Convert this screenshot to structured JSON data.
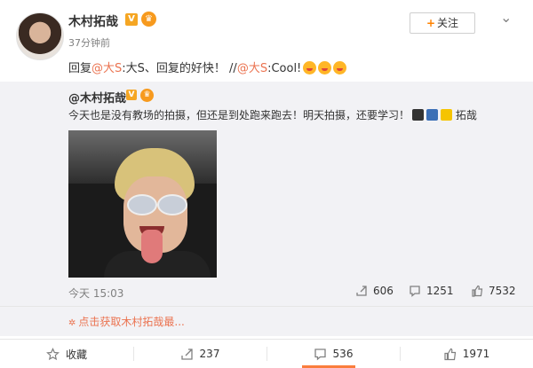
{
  "post": {
    "author": "木村拓哉",
    "vip_label": "V",
    "time": "37分钟前",
    "follow_label": "关注",
    "follow_plus": "+",
    "repost": {
      "prefix": "回复",
      "mention1": "@大S",
      "text1": ":大S、回复的好快！ //",
      "mention2": "@大S",
      "text2": ":Cool!"
    }
  },
  "quoted": {
    "author": "@木村拓哉",
    "vip_label": "V",
    "text": "今天也是没有教场的拍摄，但还是到处跑来跑去！明天拍摄，还要学习！",
    "signature": "拓哉",
    "time": "今天 15:03",
    "stats": {
      "reposts": "606",
      "comments": "1251",
      "likes": "7532"
    }
  },
  "more_link": "点击获取木村拓哉最...",
  "footer": {
    "favorite": "收藏",
    "repost": "237",
    "comment": "536",
    "like": "1971"
  },
  "colors": {
    "link": "#eb7350",
    "accent": "#ff8200",
    "quote_bg": "#f2f2f5"
  }
}
